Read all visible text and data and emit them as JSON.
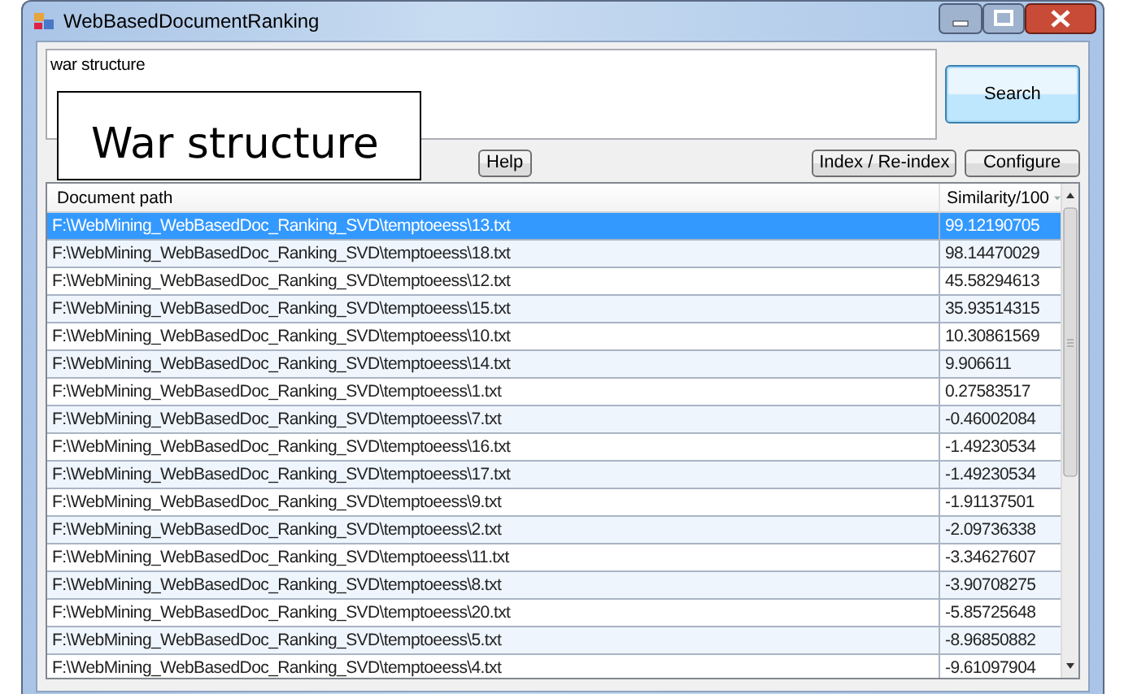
{
  "window": {
    "title": "WebBasedDocumentRanking"
  },
  "query": {
    "value": "war structure"
  },
  "callout": {
    "text": "War structure"
  },
  "buttons": {
    "search": "Search",
    "help": "Help",
    "index": "Index / Re-index",
    "configure": "Configure"
  },
  "table": {
    "columns": [
      "Document path",
      "Similarity/100"
    ],
    "rows": [
      {
        "path": "F:\\WebMining_WebBasedDoc_Ranking_SVD\\temptoeess\\13.txt",
        "similarity": "99.12190705",
        "selected": true
      },
      {
        "path": "F:\\WebMining_WebBasedDoc_Ranking_SVD\\temptoeess\\18.txt",
        "similarity": "98.14470029",
        "selected": false
      },
      {
        "path": "F:\\WebMining_WebBasedDoc_Ranking_SVD\\temptoeess\\12.txt",
        "similarity": "45.58294613",
        "selected": false
      },
      {
        "path": "F:\\WebMining_WebBasedDoc_Ranking_SVD\\temptoeess\\15.txt",
        "similarity": "35.93514315",
        "selected": false
      },
      {
        "path": "F:\\WebMining_WebBasedDoc_Ranking_SVD\\temptoeess\\10.txt",
        "similarity": "10.30861569",
        "selected": false
      },
      {
        "path": "F:\\WebMining_WebBasedDoc_Ranking_SVD\\temptoeess\\14.txt",
        "similarity": "9.906611",
        "selected": false
      },
      {
        "path": "F:\\WebMining_WebBasedDoc_Ranking_SVD\\temptoeess\\1.txt",
        "similarity": "0.27583517",
        "selected": false
      },
      {
        "path": "F:\\WebMining_WebBasedDoc_Ranking_SVD\\temptoeess\\7.txt",
        "similarity": "-0.46002084",
        "selected": false
      },
      {
        "path": "F:\\WebMining_WebBasedDoc_Ranking_SVD\\temptoeess\\16.txt",
        "similarity": "-1.49230534",
        "selected": false
      },
      {
        "path": "F:\\WebMining_WebBasedDoc_Ranking_SVD\\temptoeess\\17.txt",
        "similarity": "-1.49230534",
        "selected": false
      },
      {
        "path": "F:\\WebMining_WebBasedDoc_Ranking_SVD\\temptoeess\\9.txt",
        "similarity": "-1.91137501",
        "selected": false
      },
      {
        "path": "F:\\WebMining_WebBasedDoc_Ranking_SVD\\temptoeess\\2.txt",
        "similarity": "-2.09736338",
        "selected": false
      },
      {
        "path": "F:\\WebMining_WebBasedDoc_Ranking_SVD\\temptoeess\\11.txt",
        "similarity": "-3.34627607",
        "selected": false
      },
      {
        "path": "F:\\WebMining_WebBasedDoc_Ranking_SVD\\temptoeess\\8.txt",
        "similarity": "-3.90708275",
        "selected": false
      },
      {
        "path": "F:\\WebMining_WebBasedDoc_Ranking_SVD\\temptoeess\\20.txt",
        "similarity": "-5.85725648",
        "selected": false
      },
      {
        "path": "F:\\WebMining_WebBasedDoc_Ranking_SVD\\temptoeess\\5.txt",
        "similarity": "-8.96850882",
        "selected": false
      },
      {
        "path": "F:\\WebMining_WebBasedDoc_Ranking_SVD\\temptoeess\\4.txt",
        "similarity": "-9.61097904",
        "selected": false
      }
    ]
  }
}
